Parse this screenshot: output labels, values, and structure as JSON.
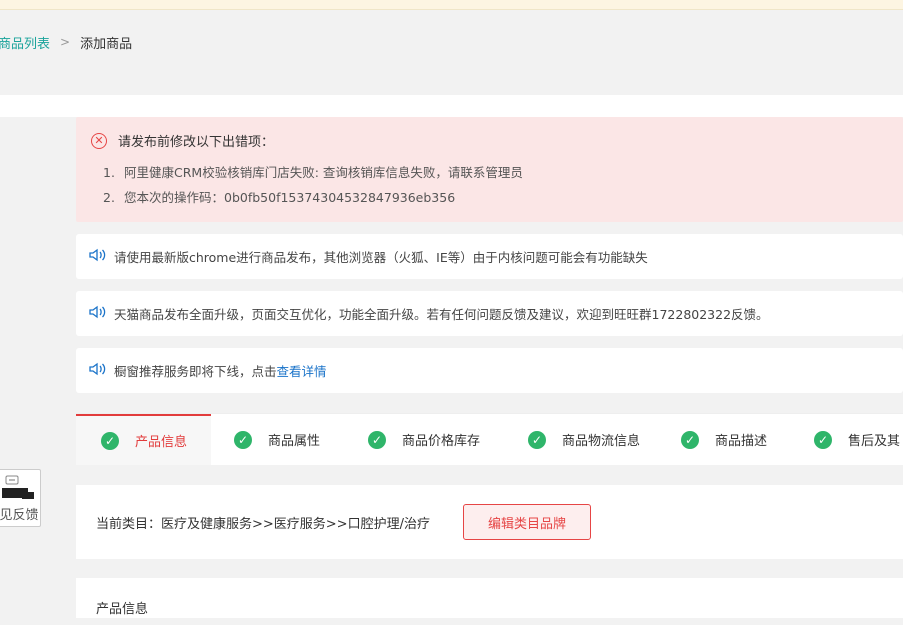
{
  "breadcrumb": {
    "parent": "商品列表",
    "separator": ">",
    "current": "添加商品"
  },
  "error_box": {
    "title": "请发布前修改以下出错项：",
    "items": [
      {
        "num": "1.",
        "text": "阿里健康CRM校验核销库门店失败: 查询核销库信息失败，请联系管理员"
      },
      {
        "num": "2.",
        "text": "您本次的操作码：0b0fb50f15374304532847936eb356"
      }
    ]
  },
  "notices": [
    {
      "text": "请使用最新版chrome进行商品发布，其他浏览器（火狐、IE等）由于内核问题可能会有功能缺失"
    },
    {
      "text": "天猫商品发布全面升级，页面交互优化，功能全面升级。若有任何问题反馈及建议，欢迎到旺旺群1722802322反馈。"
    },
    {
      "text": "橱窗推荐服务即将下线，点击",
      "link": "查看详情"
    }
  ],
  "tabs": [
    {
      "label": "产品信息",
      "active": true
    },
    {
      "label": "商品属性"
    },
    {
      "label": "商品价格库存"
    },
    {
      "label": "商品物流信息"
    },
    {
      "label": "商品描述"
    },
    {
      "label": "售后及其"
    }
  ],
  "category": {
    "text": "当前类目：医疗及健康服务>>医疗服务>>口腔护理/治疗",
    "edit_button": "编辑类目品牌"
  },
  "product_section": {
    "title": "产品信息"
  },
  "feedback": {
    "label": "意见反馈"
  },
  "colors": {
    "accent_red": "#e64545",
    "link_teal": "#1aa39b",
    "link_blue": "#1a73c9",
    "check_green": "#2fb56a",
    "error_bg": "#fbe6e6"
  },
  "icons": [
    "error-circle-icon",
    "speaker-icon",
    "check-icon",
    "feedback-icon"
  ]
}
